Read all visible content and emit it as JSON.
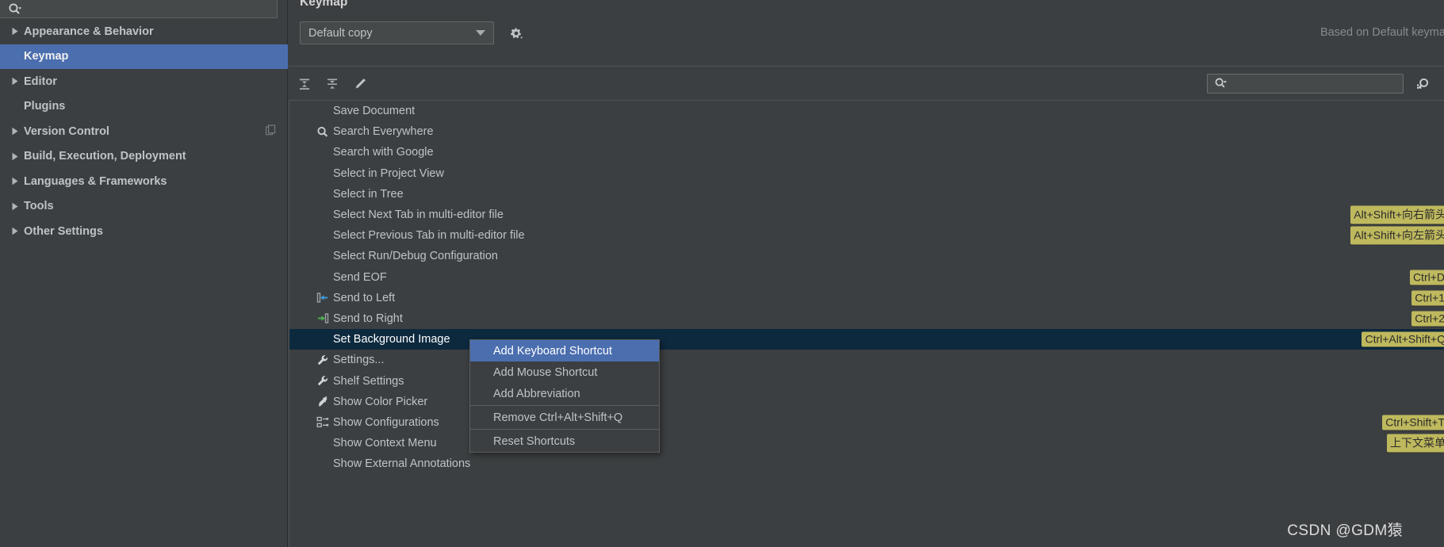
{
  "sidebar": {
    "search": {
      "placeholder": "",
      "value": "",
      "icon": "search-icon"
    },
    "items": [
      {
        "label": "Appearance & Behavior",
        "expandable": true,
        "selected": false,
        "child": false,
        "trailing_icon": ""
      },
      {
        "label": "Keymap",
        "expandable": false,
        "selected": true,
        "child": true,
        "trailing_icon": ""
      },
      {
        "label": "Editor",
        "expandable": true,
        "selected": false,
        "child": false,
        "trailing_icon": ""
      },
      {
        "label": "Plugins",
        "expandable": false,
        "selected": false,
        "child": true,
        "trailing_icon": ""
      },
      {
        "label": "Version Control",
        "expandable": true,
        "selected": false,
        "child": false,
        "trailing_icon": "copy-icon"
      },
      {
        "label": "Build, Execution, Deployment",
        "expandable": true,
        "selected": false,
        "child": false,
        "trailing_icon": ""
      },
      {
        "label": "Languages & Frameworks",
        "expandable": true,
        "selected": false,
        "child": false,
        "trailing_icon": ""
      },
      {
        "label": "Tools",
        "expandable": true,
        "selected": false,
        "child": false,
        "trailing_icon": ""
      },
      {
        "label": "Other Settings",
        "expandable": true,
        "selected": false,
        "child": false,
        "trailing_icon": ""
      }
    ]
  },
  "main": {
    "title": "Keymap",
    "keymap_select": {
      "value": "Default copy",
      "icon": "chevron-down-icon"
    },
    "gear_button": {
      "icon": "gear-icon"
    },
    "based_on": "Based on Default keymap",
    "toolbar": {
      "expand_all": {
        "icon": "expand-all-icon"
      },
      "collapse_all": {
        "icon": "collapse-all-icon"
      },
      "edit": {
        "icon": "pencil-icon"
      },
      "filter": {
        "placeholder": "",
        "value": "",
        "icon": "search-dropdown-icon"
      },
      "find_by_shortcut": {
        "icon": "find-by-shortcut-icon"
      }
    },
    "actions": [
      {
        "label": "Save Document",
        "icon": "",
        "shortcut": "",
        "selected": false
      },
      {
        "label": "Search Everywhere",
        "icon": "search-icon",
        "shortcut": "",
        "selected": false
      },
      {
        "label": "Search with Google",
        "icon": "",
        "shortcut": "",
        "selected": false
      },
      {
        "label": "Select in Project View",
        "icon": "",
        "shortcut": "",
        "selected": false
      },
      {
        "label": "Select in Tree",
        "icon": "",
        "shortcut": "",
        "selected": false
      },
      {
        "label": "Select Next Tab in multi-editor file",
        "icon": "",
        "shortcut": "Alt+Shift+向右箭头",
        "selected": false
      },
      {
        "label": "Select Previous Tab in multi-editor file",
        "icon": "",
        "shortcut": "Alt+Shift+向左箭头",
        "selected": false
      },
      {
        "label": "Select Run/Debug Configuration",
        "icon": "",
        "shortcut": "",
        "selected": false
      },
      {
        "label": "Send EOF",
        "icon": "",
        "shortcut": "Ctrl+D",
        "selected": false
      },
      {
        "label": "Send to Left",
        "icon": "send-left-icon",
        "shortcut": "Ctrl+1",
        "selected": false
      },
      {
        "label": "Send to Right",
        "icon": "send-right-icon",
        "shortcut": "Ctrl+2",
        "selected": false
      },
      {
        "label": "Set Background Image",
        "icon": "",
        "shortcut": "Ctrl+Alt+Shift+Q",
        "selected": true
      },
      {
        "label": "Settings...",
        "icon": "wrench-icon",
        "shortcut": "",
        "selected": false
      },
      {
        "label": "Shelf Settings",
        "icon": "wrench-icon",
        "shortcut": "",
        "selected": false
      },
      {
        "label": "Show Color Picker",
        "icon": "colorpicker-icon",
        "shortcut": "",
        "selected": false
      },
      {
        "label": "Show Configurations",
        "icon": "config-icon",
        "shortcut": "Ctrl+Shift+T",
        "selected": false
      },
      {
        "label": "Show Context Menu",
        "icon": "",
        "shortcut": "上下文菜单",
        "selected": false
      },
      {
        "label": "Show External Annotations",
        "icon": "",
        "shortcut": "",
        "selected": false
      }
    ]
  },
  "context_menu": {
    "items": [
      {
        "label": "Add Keyboard Shortcut",
        "highlighted": true,
        "separator_after": false
      },
      {
        "label": "Add Mouse Shortcut",
        "highlighted": false,
        "separator_after": false
      },
      {
        "label": "Add Abbreviation",
        "highlighted": false,
        "separator_after": true
      },
      {
        "label": "Remove Ctrl+Alt+Shift+Q",
        "highlighted": false,
        "separator_after": true
      },
      {
        "label": "Reset Shortcuts",
        "highlighted": false,
        "separator_after": false
      }
    ]
  },
  "watermark": "CSDN @GDM猿",
  "colors": {
    "background": "#3c3f41",
    "selection_blue": "#4b6eaf",
    "row_selection": "#0d293e",
    "shortcut_badge": "#bfb95e",
    "text": "#bfc3c7",
    "muted_text": "#878b8d"
  }
}
